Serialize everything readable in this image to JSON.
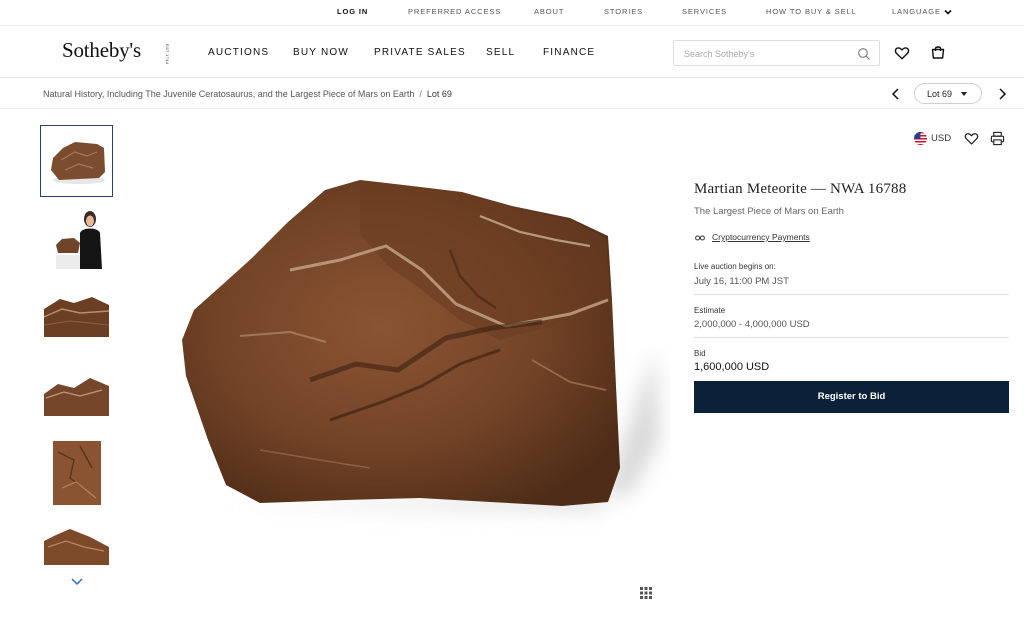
{
  "utility": {
    "login": "LOG IN",
    "preferred_access": "PREFERRED ACCESS",
    "about": "ABOUT",
    "stories": "STORIES",
    "services": "SERVICES",
    "how_to_buy_sell": "HOW TO BUY & SELL",
    "language": "LANGUAGE"
  },
  "nav": {
    "logo": "Sotheby's",
    "logo_est": "EST 1744",
    "auctions": "AUCTIONS",
    "buy_now": "BUY NOW",
    "private_sales": "PRIVATE SALES",
    "sell": "SELL",
    "finance": "FINANCE",
    "search_placeholder": "Search Sotheby's"
  },
  "breadcrumb": {
    "sale": "Natural History, Including The Juvenile Ceratosaurus, and the Largest Piece of Mars on Earth",
    "separator": "/",
    "current": "Lot 69",
    "lot_selector": "Lot 69"
  },
  "lot": {
    "currency": "USD",
    "title": "Martian Meteorite — NWA 16788",
    "subtitle": "The Largest Piece of Mars on Earth",
    "crypto_link": "Cryptocurrency Payments",
    "auction_label": "Live auction begins on:",
    "auction_date": "July 16, 11:00 PM JST",
    "estimate_label": "Estimate",
    "estimate_value": "2,000,000 - 4,000,000 USD",
    "bid_label": "Bid",
    "bid_value": "1,600,000 USD",
    "register_button": "Register to Bid"
  },
  "colors": {
    "button_navy": "#0c2139",
    "thumb_selected_border": "#2c3e6b",
    "rock_brown": "#7a4a2a"
  },
  "icons": [
    "chevron-down-icon",
    "search-icon",
    "heart-icon",
    "shopping-bag-icon",
    "chevron-left-icon",
    "chevron-right-icon",
    "us-flag-icon",
    "print-icon",
    "glasses-icon",
    "grid-icon"
  ]
}
